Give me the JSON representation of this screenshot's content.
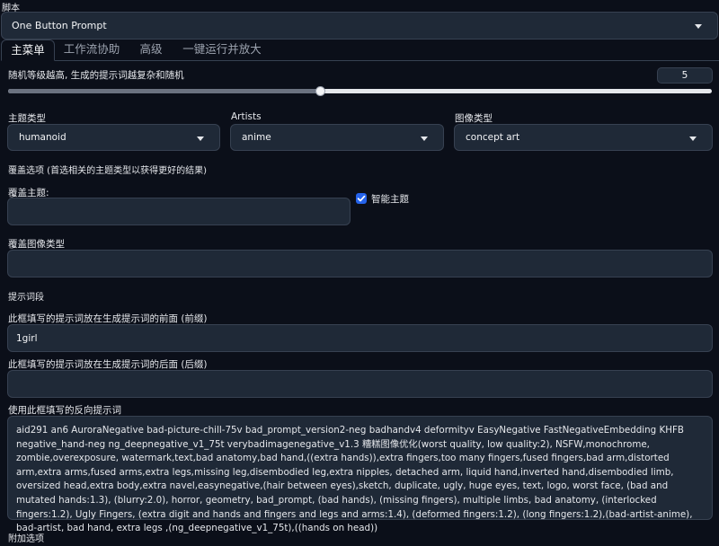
{
  "script": {
    "label": "脚本",
    "selected": "One Button Prompt"
  },
  "tabs": [
    {
      "label": "主菜单"
    },
    {
      "label": "工作流协助"
    },
    {
      "label": "高级"
    },
    {
      "label": "一键运行并放大"
    }
  ],
  "randomness": {
    "label": "随机等级越高, 生成的提示词越复杂和随机",
    "value": "5",
    "fraction": 0.444
  },
  "subject_type": {
    "label": "主题类型",
    "value": "humanoid"
  },
  "artists": {
    "label": "Artists",
    "value": "anime"
  },
  "image_type": {
    "label": "图像类型",
    "value": "concept art"
  },
  "override_section": {
    "label": "覆盖选项 (首选相关的主题类型以获得更好的结果)"
  },
  "override_subject": {
    "label": "覆盖主题:",
    "value": ""
  },
  "smart_subject": {
    "label": "智能主题",
    "checked": true
  },
  "override_image_type": {
    "label": "覆盖图像类型",
    "value": ""
  },
  "prompt_section": {
    "label": "提示词段"
  },
  "prefix": {
    "label": "此框填写的提示词放在生成提示词的前面 (前缀)",
    "value": "1girl"
  },
  "suffix": {
    "label": "此框填写的提示词放在生成提示词的后面 (后缀)",
    "value": ""
  },
  "negative": {
    "label": "使用此框填写的反向提示词",
    "value": "aid291 an6 AuroraNegative bad-picture-chill-75v bad_prompt_version2-neg badhandv4 deformityv EasyNegative FastNegativeEmbedding KHFB negative_hand-neg ng_deepnegative_v1_75t verybadimagenegative_v1.3 糟糕图像优化(worst quality, low quality:2), NSFW,monochrome, zombie,overexposure, watermark,text,bad anatomy,bad hand,((extra hands)),extra fingers,too many fingers,fused fingers,bad arm,distorted arm,extra arms,fused arms,extra legs,missing leg,disembodied leg,extra nipples, detached arm, liquid hand,inverted hand,disembodied limb, oversized head,extra body,extra navel,easynegative,(hair between eyes),sketch, duplicate, ugly, huge eyes, text, logo, worst face, (bad and mutated hands:1.3), (blurry:2.0), horror, geometry, bad_prompt, (bad hands), (missing fingers), multiple limbs, bad anatomy, (interlocked fingers:1.2), Ugly Fingers, (extra digit and hands and fingers and legs and arms:1.4), (deformed fingers:1.2), (long fingers:1.2),(bad-artist-anime), bad-artist, bad hand, extra legs ,(ng_deepnegative_v1_75t),((hands on head))"
  },
  "extra_section": {
    "label": "附加选项"
  },
  "colors": {
    "accent": "#2563eb",
    "background": "#0b0f19",
    "field": "#1f2937",
    "border": "#374151"
  }
}
